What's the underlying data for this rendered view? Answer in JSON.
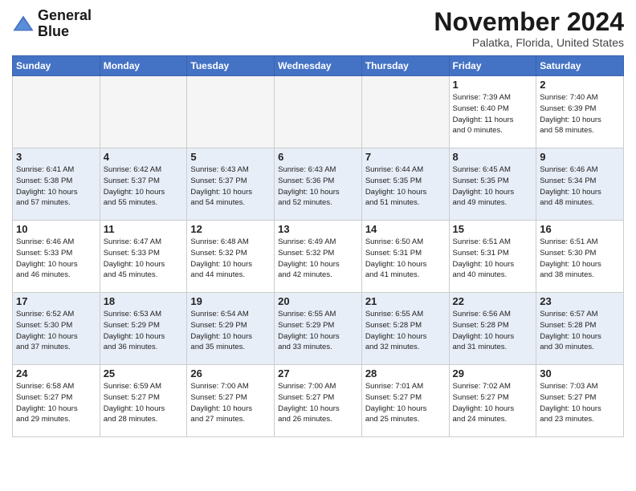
{
  "header": {
    "logo_line1": "General",
    "logo_line2": "Blue",
    "month": "November 2024",
    "location": "Palatka, Florida, United States"
  },
  "weekdays": [
    "Sunday",
    "Monday",
    "Tuesday",
    "Wednesday",
    "Thursday",
    "Friday",
    "Saturday"
  ],
  "weeks": [
    [
      {
        "day": "",
        "info": ""
      },
      {
        "day": "",
        "info": ""
      },
      {
        "day": "",
        "info": ""
      },
      {
        "day": "",
        "info": ""
      },
      {
        "day": "",
        "info": ""
      },
      {
        "day": "1",
        "info": "Sunrise: 7:39 AM\nSunset: 6:40 PM\nDaylight: 11 hours\nand 0 minutes."
      },
      {
        "day": "2",
        "info": "Sunrise: 7:40 AM\nSunset: 6:39 PM\nDaylight: 10 hours\nand 58 minutes."
      }
    ],
    [
      {
        "day": "3",
        "info": "Sunrise: 6:41 AM\nSunset: 5:38 PM\nDaylight: 10 hours\nand 57 minutes."
      },
      {
        "day": "4",
        "info": "Sunrise: 6:42 AM\nSunset: 5:37 PM\nDaylight: 10 hours\nand 55 minutes."
      },
      {
        "day": "5",
        "info": "Sunrise: 6:43 AM\nSunset: 5:37 PM\nDaylight: 10 hours\nand 54 minutes."
      },
      {
        "day": "6",
        "info": "Sunrise: 6:43 AM\nSunset: 5:36 PM\nDaylight: 10 hours\nand 52 minutes."
      },
      {
        "day": "7",
        "info": "Sunrise: 6:44 AM\nSunset: 5:35 PM\nDaylight: 10 hours\nand 51 minutes."
      },
      {
        "day": "8",
        "info": "Sunrise: 6:45 AM\nSunset: 5:35 PM\nDaylight: 10 hours\nand 49 minutes."
      },
      {
        "day": "9",
        "info": "Sunrise: 6:46 AM\nSunset: 5:34 PM\nDaylight: 10 hours\nand 48 minutes."
      }
    ],
    [
      {
        "day": "10",
        "info": "Sunrise: 6:46 AM\nSunset: 5:33 PM\nDaylight: 10 hours\nand 46 minutes."
      },
      {
        "day": "11",
        "info": "Sunrise: 6:47 AM\nSunset: 5:33 PM\nDaylight: 10 hours\nand 45 minutes."
      },
      {
        "day": "12",
        "info": "Sunrise: 6:48 AM\nSunset: 5:32 PM\nDaylight: 10 hours\nand 44 minutes."
      },
      {
        "day": "13",
        "info": "Sunrise: 6:49 AM\nSunset: 5:32 PM\nDaylight: 10 hours\nand 42 minutes."
      },
      {
        "day": "14",
        "info": "Sunrise: 6:50 AM\nSunset: 5:31 PM\nDaylight: 10 hours\nand 41 minutes."
      },
      {
        "day": "15",
        "info": "Sunrise: 6:51 AM\nSunset: 5:31 PM\nDaylight: 10 hours\nand 40 minutes."
      },
      {
        "day": "16",
        "info": "Sunrise: 6:51 AM\nSunset: 5:30 PM\nDaylight: 10 hours\nand 38 minutes."
      }
    ],
    [
      {
        "day": "17",
        "info": "Sunrise: 6:52 AM\nSunset: 5:30 PM\nDaylight: 10 hours\nand 37 minutes."
      },
      {
        "day": "18",
        "info": "Sunrise: 6:53 AM\nSunset: 5:29 PM\nDaylight: 10 hours\nand 36 minutes."
      },
      {
        "day": "19",
        "info": "Sunrise: 6:54 AM\nSunset: 5:29 PM\nDaylight: 10 hours\nand 35 minutes."
      },
      {
        "day": "20",
        "info": "Sunrise: 6:55 AM\nSunset: 5:29 PM\nDaylight: 10 hours\nand 33 minutes."
      },
      {
        "day": "21",
        "info": "Sunrise: 6:55 AM\nSunset: 5:28 PM\nDaylight: 10 hours\nand 32 minutes."
      },
      {
        "day": "22",
        "info": "Sunrise: 6:56 AM\nSunset: 5:28 PM\nDaylight: 10 hours\nand 31 minutes."
      },
      {
        "day": "23",
        "info": "Sunrise: 6:57 AM\nSunset: 5:28 PM\nDaylight: 10 hours\nand 30 minutes."
      }
    ],
    [
      {
        "day": "24",
        "info": "Sunrise: 6:58 AM\nSunset: 5:27 PM\nDaylight: 10 hours\nand 29 minutes."
      },
      {
        "day": "25",
        "info": "Sunrise: 6:59 AM\nSunset: 5:27 PM\nDaylight: 10 hours\nand 28 minutes."
      },
      {
        "day": "26",
        "info": "Sunrise: 7:00 AM\nSunset: 5:27 PM\nDaylight: 10 hours\nand 27 minutes."
      },
      {
        "day": "27",
        "info": "Sunrise: 7:00 AM\nSunset: 5:27 PM\nDaylight: 10 hours\nand 26 minutes."
      },
      {
        "day": "28",
        "info": "Sunrise: 7:01 AM\nSunset: 5:27 PM\nDaylight: 10 hours\nand 25 minutes."
      },
      {
        "day": "29",
        "info": "Sunrise: 7:02 AM\nSunset: 5:27 PM\nDaylight: 10 hours\nand 24 minutes."
      },
      {
        "day": "30",
        "info": "Sunrise: 7:03 AM\nSunset: 5:27 PM\nDaylight: 10 hours\nand 23 minutes."
      }
    ]
  ]
}
